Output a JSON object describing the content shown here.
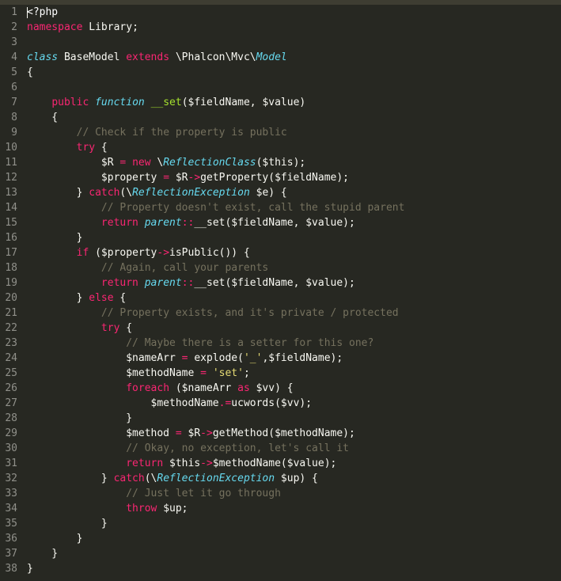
{
  "line_numbers": [
    "1",
    "2",
    "3",
    "4",
    "5",
    "6",
    "7",
    "8",
    "9",
    "10",
    "11",
    "12",
    "13",
    "14",
    "15",
    "16",
    "17",
    "18",
    "19",
    "20",
    "21",
    "22",
    "23",
    "24",
    "25",
    "26",
    "27",
    "28",
    "29",
    "30",
    "31",
    "32",
    "33",
    "34",
    "35",
    "36",
    "37",
    "38"
  ],
  "code": {
    "l1": {
      "a": "<?php"
    },
    "l2": {
      "a": "namespace",
      "b": " Library;"
    },
    "l4": {
      "a": "class",
      "b": " BaseModel ",
      "c": "extends",
      "d": " \\Phalcon\\Mvc\\",
      "e": "Model"
    },
    "l5": {
      "a": "{"
    },
    "l7": {
      "a": "    ",
      "b": "public",
      "c": " ",
      "d": "function",
      "e": " ",
      "f": "__set",
      "g": "($fieldName, $value)"
    },
    "l8": {
      "a": "    {"
    },
    "l9": {
      "a": "        ",
      "b": "// Check if the property is public"
    },
    "l10": {
      "a": "        ",
      "b": "try",
      "c": " {"
    },
    "l11": {
      "a": "            $R ",
      "b": "=",
      "c": " ",
      "d": "new",
      "e": " \\",
      "f": "ReflectionClass",
      "g": "($this);"
    },
    "l12": {
      "a": "            $property ",
      "b": "=",
      "c": " $R",
      "d": "->",
      "e": "getProperty($fieldName);"
    },
    "l13": {
      "a": "        } ",
      "b": "catch",
      "c": "(\\",
      "d": "ReflectionException",
      "e": " $e) {"
    },
    "l14": {
      "a": "            ",
      "b": "// Property doesn't exist, call the stupid parent"
    },
    "l15": {
      "a": "            ",
      "b": "return",
      "c": " ",
      "d": "parent",
      "e": "::",
      "f": "__set($fieldName, $value);"
    },
    "l16": {
      "a": "        }"
    },
    "l17": {
      "a": "        ",
      "b": "if",
      "c": " ($property",
      "d": "->",
      "e": "isPublic()) {"
    },
    "l18": {
      "a": "            ",
      "b": "// Again, call your parents"
    },
    "l19": {
      "a": "            ",
      "b": "return",
      "c": " ",
      "d": "parent",
      "e": "::",
      "f": "__set($fieldName, $value);"
    },
    "l20": {
      "a": "        } ",
      "b": "else",
      "c": " {"
    },
    "l21": {
      "a": "            ",
      "b": "// Property exists, and it's private / protected"
    },
    "l22": {
      "a": "            ",
      "b": "try",
      "c": " {"
    },
    "l23": {
      "a": "                ",
      "b": "// Maybe there is a setter for this one?"
    },
    "l24": {
      "a": "                $nameArr ",
      "b": "=",
      "c": " explode(",
      "d": "'_'",
      "e": ",$fieldName);"
    },
    "l25": {
      "a": "                $methodName ",
      "b": "=",
      "c": " ",
      "d": "'set'",
      "e": ";"
    },
    "l26": {
      "a": "                ",
      "b": "foreach",
      "c": " ($nameArr ",
      "d": "as",
      "e": " $vv) {"
    },
    "l27": {
      "a": "                    $methodName",
      "b": ".=",
      "c": "ucwords($vv);"
    },
    "l28": {
      "a": "                }"
    },
    "l29": {
      "a": "                $method ",
      "b": "=",
      "c": " $R",
      "d": "->",
      "e": "getMethod($methodName);"
    },
    "l30": {
      "a": "                ",
      "b": "// Okay, no exception, let's call it"
    },
    "l31": {
      "a": "                ",
      "b": "return",
      "c": " $this",
      "d": "->",
      "e": "$methodName($value);"
    },
    "l32": {
      "a": "            } ",
      "b": "catch",
      "c": "(\\",
      "d": "ReflectionException",
      "e": " $up) {"
    },
    "l33": {
      "a": "                ",
      "b": "// Just let it go through"
    },
    "l34": {
      "a": "                ",
      "b": "throw",
      "c": " $up;"
    },
    "l35": {
      "a": "            }"
    },
    "l36": {
      "a": "        }"
    },
    "l37": {
      "a": "    }"
    },
    "l38": {
      "a": "}"
    }
  }
}
